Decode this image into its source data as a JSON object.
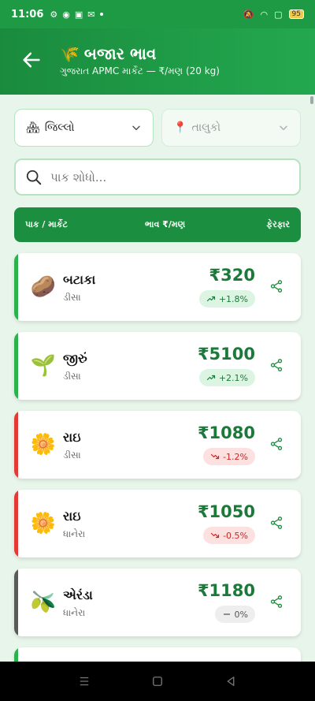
{
  "status": {
    "time": "11:06",
    "battery": "95"
  },
  "header": {
    "title": "બજાર ભાવ",
    "title_emoji": "🌾",
    "subtitle": "ગુજરાત APMC માર્કેટ — ₹/મણ (20 kg)"
  },
  "filters": {
    "district": {
      "label": "જિલ્લો",
      "icon": "🏘"
    },
    "taluka": {
      "label": "તાલુકો",
      "icon": "📍"
    }
  },
  "search": {
    "placeholder": "પાક શોધો..."
  },
  "table_header": {
    "crop_market": "પાક / માર્કેટ",
    "price": "ભાવ ₹/મણ",
    "change": "ફેરફાર"
  },
  "colors": {
    "up": "#2bb24c",
    "down": "#e53935",
    "flat": "#5a5a5a",
    "accent": "#1b8e3f"
  },
  "rows": [
    {
      "emoji": "🥔",
      "name": "બટાકા",
      "market": "ડીસા",
      "price": "₹320",
      "change": "+1.8%",
      "trend": "up"
    },
    {
      "emoji": "🌱",
      "name": "જીરું",
      "market": "ડીસા",
      "price": "₹5100",
      "change": "+2.1%",
      "trend": "up"
    },
    {
      "emoji": "🌼",
      "name": "રાઇ",
      "market": "ડીસા",
      "price": "₹1080",
      "change": "-1.2%",
      "trend": "down"
    },
    {
      "emoji": "🌼",
      "name": "રાઇ",
      "market": "ધાનેરા",
      "price": "₹1050",
      "change": "-0.5%",
      "trend": "down"
    },
    {
      "emoji": "🫒",
      "name": "એરંડા",
      "market": "ધાનેરા",
      "price": "₹1180",
      "change": "0%",
      "trend": "flat"
    }
  ]
}
